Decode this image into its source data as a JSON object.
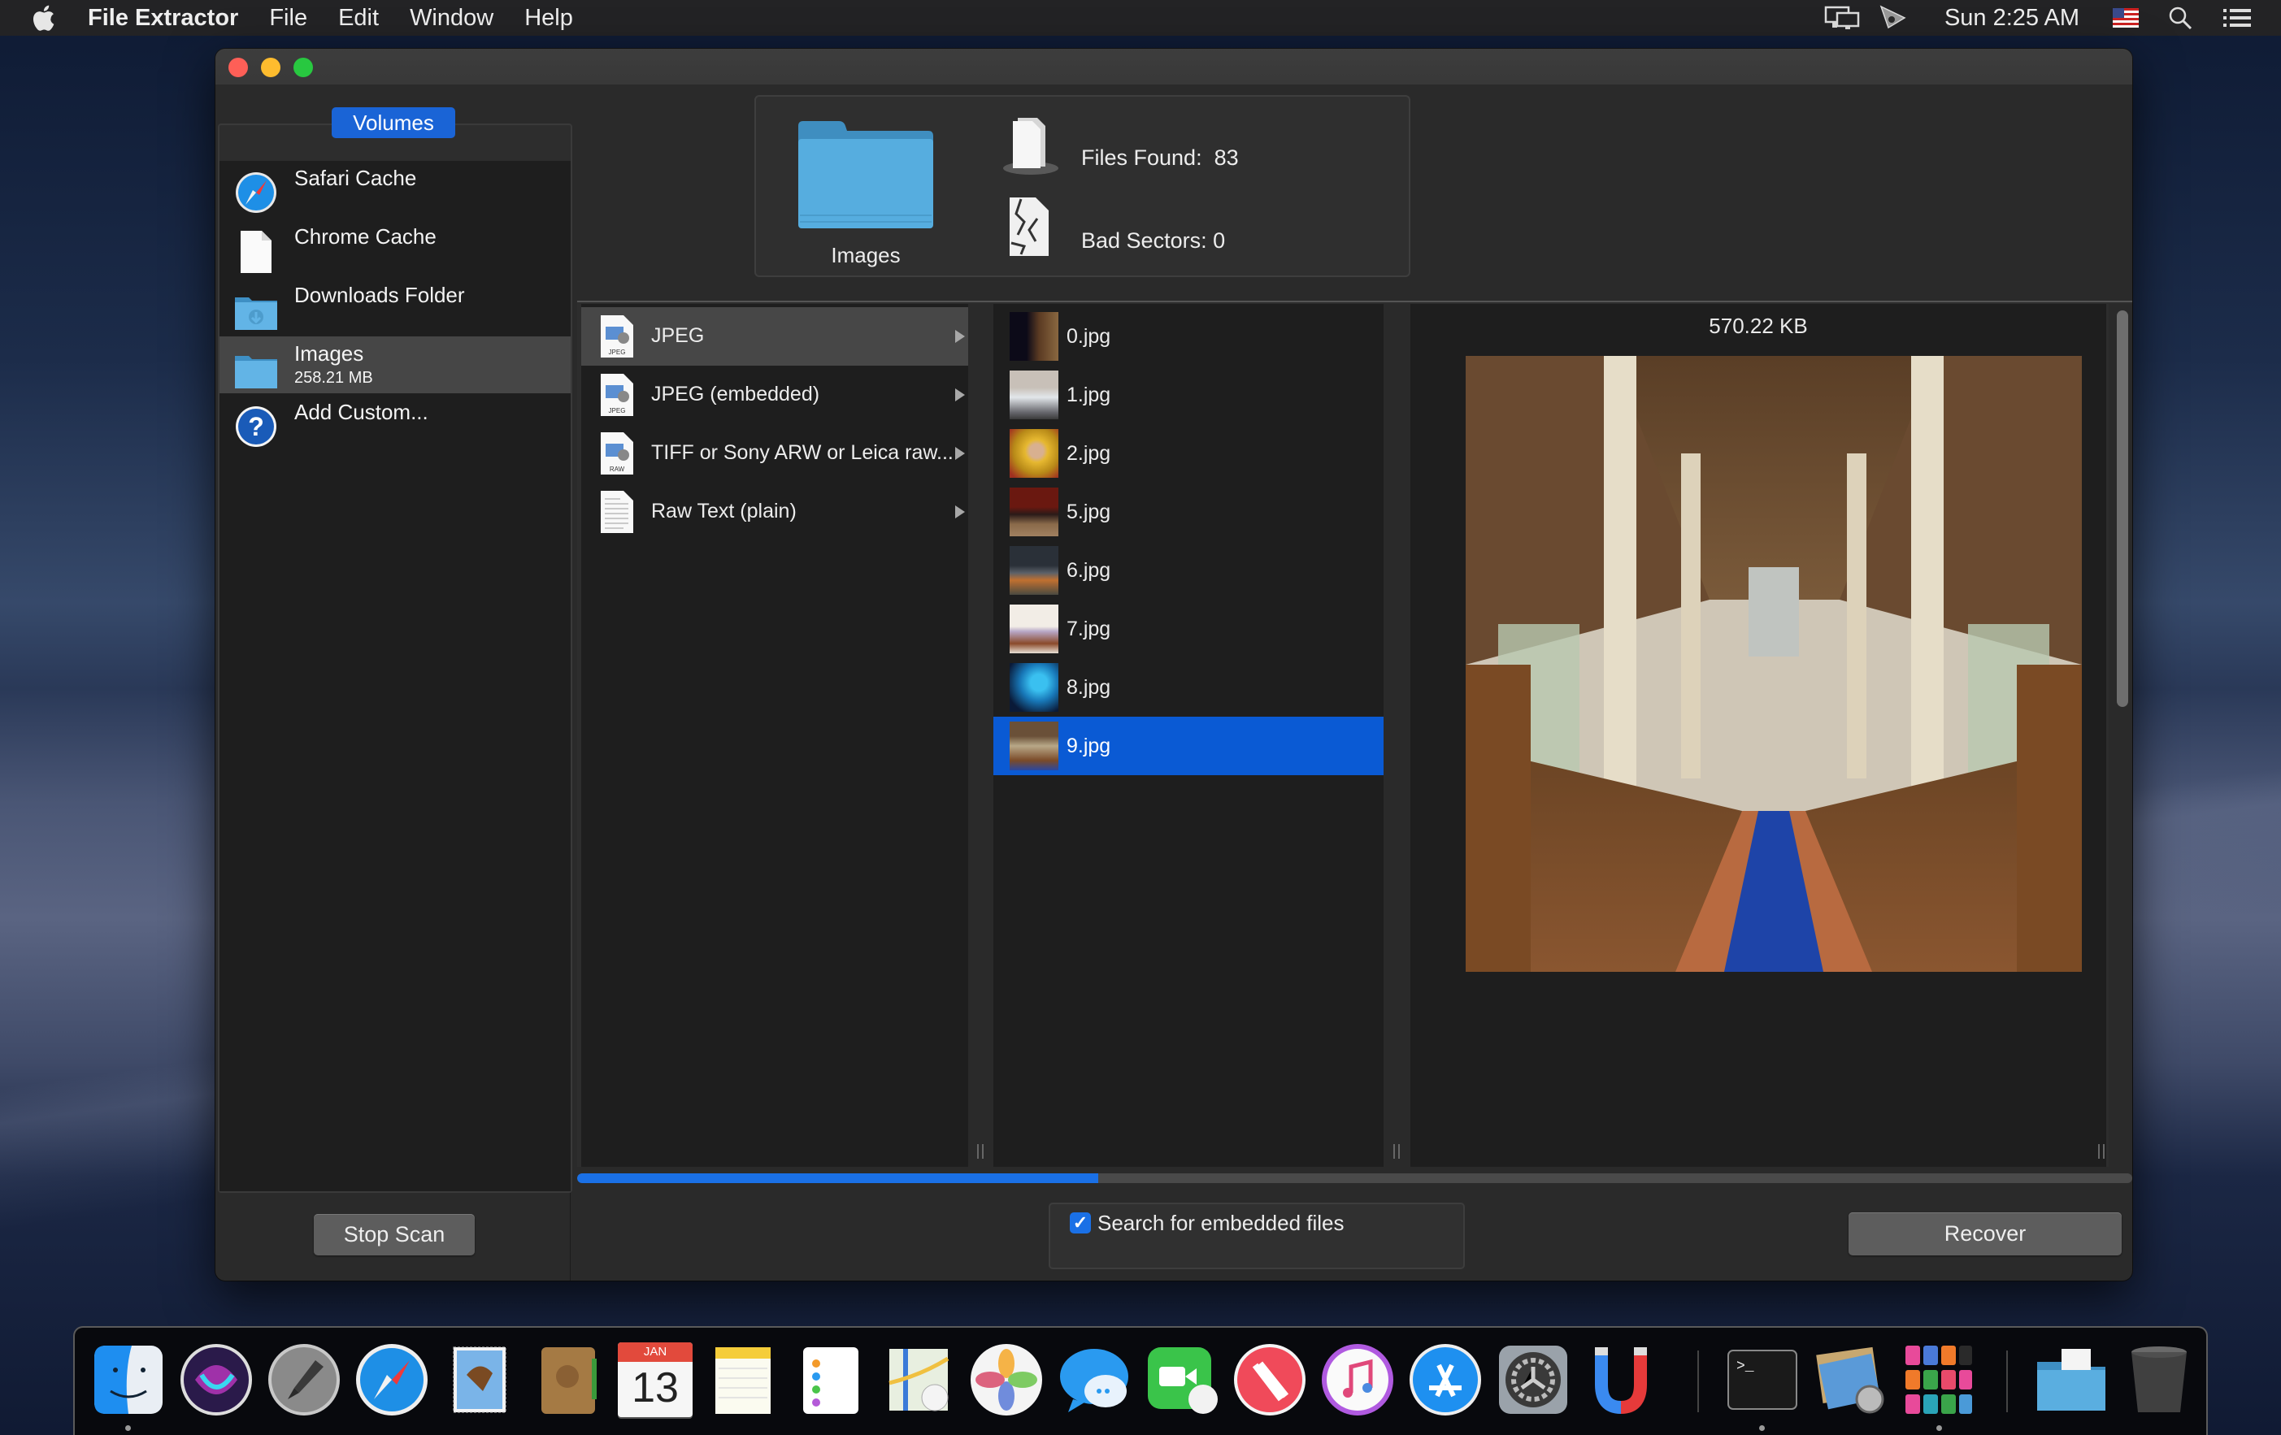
{
  "menubar": {
    "app_name": "File Extractor",
    "menus": [
      "File",
      "Edit",
      "Window",
      "Help"
    ],
    "clock": "Sun 2:25 AM",
    "status_icons": [
      "display-mirroring-icon",
      "screen-share-icon",
      "us-flag-input-icon",
      "spotlight-search-icon",
      "notification-center-icon"
    ]
  },
  "window": {
    "sidebar": {
      "header": "Volumes",
      "items": [
        {
          "label": "Safari Cache",
          "icon": "safari-icon",
          "selected": false
        },
        {
          "label": "Chrome Cache",
          "icon": "blank-document-icon",
          "selected": false
        },
        {
          "label": "Downloads Folder",
          "icon": "downloads-folder-icon",
          "selected": false
        },
        {
          "label": "Images",
          "sub": "258.21 MB",
          "icon": "folder-icon",
          "selected": true
        },
        {
          "label": "Add Custom...",
          "icon": "help-question-icon",
          "selected": false
        }
      ],
      "stop_button": "Stop Scan"
    },
    "info": {
      "folder_label": "Images",
      "files_found_label": "Files Found:",
      "files_found": "83",
      "bad_sectors_label": "Bad Sectors:",
      "bad_sectors": "0"
    },
    "types": [
      {
        "label": "JPEG",
        "badge": "JPEG",
        "selected": true
      },
      {
        "label": "JPEG (embedded)",
        "badge": "JPEG",
        "selected": false
      },
      {
        "label": "TIFF or Sony ARW or Leica raw...",
        "badge": "RAW",
        "selected": false
      },
      {
        "label": "Raw Text (plain)",
        "badge": "",
        "selected": false
      }
    ],
    "files": [
      {
        "name": "0.jpg",
        "selected": false
      },
      {
        "name": "1.jpg",
        "selected": false
      },
      {
        "name": "2.jpg",
        "selected": false
      },
      {
        "name": "5.jpg",
        "selected": false
      },
      {
        "name": "6.jpg",
        "selected": false
      },
      {
        "name": "7.jpg",
        "selected": false
      },
      {
        "name": "8.jpg",
        "selected": false
      },
      {
        "name": "9.jpg",
        "selected": true
      }
    ],
    "preview": {
      "size": "570.22 KB",
      "subject": "church-nave-photo"
    },
    "scan_progress_percent": 33.5,
    "embedded_checkbox": {
      "label": "Search for embedded files",
      "checked": true
    },
    "recover_button": "Recover"
  },
  "dock": {
    "apps": [
      "Finder",
      "Siri",
      "Launchpad",
      "Safari",
      "Mail",
      "Contacts",
      "Calendar",
      "Notes",
      "Reminders",
      "Maps",
      "Photos",
      "Messages",
      "FaceTime",
      "News",
      "iTunes",
      "App Store",
      "System Preferences",
      "File Extractor",
      "Terminal",
      "Preview",
      "Documents stack",
      "Downloads folder",
      "Trash"
    ],
    "calendar_month": "JAN",
    "calendar_day": "13"
  },
  "colors": {
    "accent": "#1a64d6",
    "selection": "#0a5ad4",
    "progress": "#1a70e6"
  }
}
